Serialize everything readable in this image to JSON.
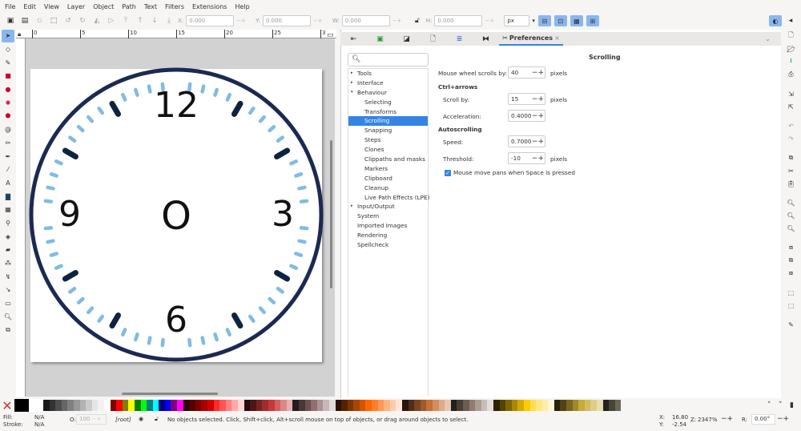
{
  "menu": [
    "File",
    "Edit",
    "View",
    "Layer",
    "Object",
    "Path",
    "Text",
    "Filters",
    "Extensions",
    "Help"
  ],
  "toolbar": {
    "x_label": "X:",
    "x": "0.000",
    "y_label": "Y:",
    "y": "0.000",
    "w_label": "W:",
    "w": "0.000",
    "h_label": "H:",
    "h": "0.000",
    "unit": "px"
  },
  "ruler": [
    "0",
    "5",
    "10",
    "15",
    "20",
    "25",
    "3"
  ],
  "canvas": {
    "numerals": {
      "n12": "12",
      "n3": "3",
      "n6": "6",
      "n9": "9",
      "center": "O"
    },
    "ring_color": "#1c2a52",
    "hour_tick_color": "#0d2340",
    "minute_tick_color": "#7fbbe5"
  },
  "dock": {
    "tab_label": "Preferences",
    "close": "×"
  },
  "tree": [
    {
      "label": "Tools",
      "level": 0,
      "arrow": "▸"
    },
    {
      "label": "Interface",
      "level": 0,
      "arrow": "▸"
    },
    {
      "label": "Behaviour",
      "level": 0,
      "arrow": "▾"
    },
    {
      "label": "Selecting",
      "level": 1
    },
    {
      "label": "Transforms",
      "level": 1
    },
    {
      "label": "Scrolling",
      "level": 1,
      "selected": true
    },
    {
      "label": "Snapping",
      "level": 1
    },
    {
      "label": "Steps",
      "level": 1
    },
    {
      "label": "Clones",
      "level": 1
    },
    {
      "label": "Clippaths and masks",
      "level": 1
    },
    {
      "label": "Markers",
      "level": 1
    },
    {
      "label": "Clipboard",
      "level": 1
    },
    {
      "label": "Cleanup",
      "level": 1
    },
    {
      "label": "Live Path Effects (LPE)",
      "level": 1
    },
    {
      "label": "Input/Output",
      "level": 0,
      "arrow": "▸"
    },
    {
      "label": "System",
      "level": 0
    },
    {
      "label": "Imported Images",
      "level": 0
    },
    {
      "label": "Rendering",
      "level": 0
    },
    {
      "label": "Spellcheck",
      "level": 0
    }
  ],
  "prefs": {
    "title": "Scrolling",
    "wheel_label": "Mouse wheel scrolls by:",
    "wheel_value": "40",
    "wheel_unit": "pixels",
    "ctrl_header": "Ctrl+arrows",
    "scroll_label": "Scroll by:",
    "scroll_value": "15",
    "scroll_unit": "pixels",
    "accel_label": "Acceleration:",
    "accel_value": "0.4000",
    "auto_header": "Autoscrolling",
    "speed_label": "Speed:",
    "speed_value": "0.7000",
    "threshold_label": "Threshold:",
    "threshold_value": "-10",
    "threshold_unit": "pixels",
    "space_pan_label": "Mouse move pans when Space is pressed",
    "space_pan_checked": true
  },
  "palette": [
    "#1a1a1a",
    "#333333",
    "#4d4d4d",
    "#666666",
    "#808080",
    "#999999",
    "#b3b3b3",
    "#cccccc",
    "#e6e6e6",
    "#f2f2f2",
    "#ffffff",
    "#800000",
    "#ff0000",
    "#808000",
    "#ffff00",
    "#008000",
    "#00ff00",
    "#008080",
    "#00ffff",
    "#000080",
    "#0000ff",
    "#800080",
    "#ff00ff",
    "#2b0000",
    "#550000",
    "#800000",
    "#aa0000",
    "#d40000",
    "#ff2a2a",
    "#ff5555",
    "#ff8080",
    "#ffaaaa",
    "#ffd5d5",
    "#280b0b",
    "#501616",
    "#782121",
    "#a02c2c",
    "#c83737",
    "#d35f5f",
    "#de8787",
    "#e9afaf",
    "#241c1c",
    "#483737",
    "#6c5353",
    "#916f6f",
    "#ac9393",
    "#c8b7b7",
    "#e3dbdb",
    "#2b1100",
    "#552200",
    "#803300",
    "#aa4400",
    "#d45500",
    "#ff6600",
    "#ff7f2a",
    "#ff9955",
    "#ffb380",
    "#ffccaa",
    "#ffe6d5",
    "#28170b",
    "#502d16",
    "#784421",
    "#a05a2c",
    "#c87137",
    "#d38d5f",
    "#deaa87",
    "#e9c6af",
    "#241f1c",
    "#483e37",
    "#6c5d53",
    "#917c6f",
    "#ac9d93",
    "#c8beb7",
    "#e3dedb",
    "#2b2200",
    "#554400",
    "#806600",
    "#aa8800",
    "#d4aa00",
    "#ffcc00",
    "#ffdd55",
    "#ffe680",
    "#ffeeaa",
    "#fff6d5",
    "#28220b",
    "#504416",
    "#786721",
    "#a0892c",
    "#c8ab37",
    "#d3bc5f",
    "#decd87",
    "#e9ddaf",
    "#24221c",
    "#484537",
    "#6c6753"
  ],
  "status": {
    "fill_label": "Fill:",
    "fill": "N/A",
    "stroke_label": "Stroke:",
    "stroke": "N/A",
    "opacity_label": "O:",
    "opacity": "100",
    "layer": "[root]",
    "message": "No objects selected. Click, Shift+click, Alt+scroll mouse on top of objects, or drag around objects to select.",
    "x_label": "X:",
    "x": "16.80",
    "y_label": "Y:",
    "y": "-2.54",
    "zoom_label": "Z:",
    "zoom": "2347%",
    "rot_label": "R:",
    "rotation": "0.00°"
  }
}
